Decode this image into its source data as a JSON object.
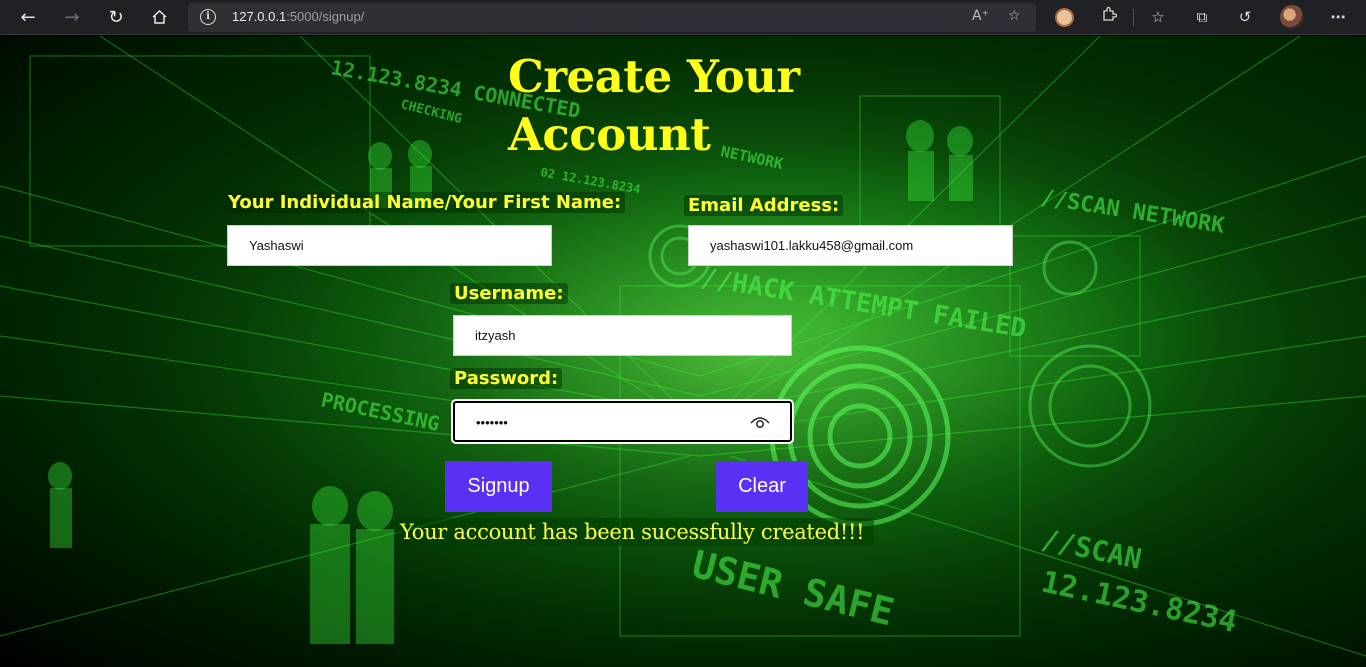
{
  "browser": {
    "url_host": "127.0.0.1",
    "url_rest": ":5000/signup/",
    "icons": [
      "back-icon",
      "forward-icon",
      "refresh-icon",
      "home-icon",
      "info-icon",
      "read-aloud-icon",
      "favorite-add-icon",
      "extension-icon",
      "favorites-icon",
      "collections-icon",
      "history-icon",
      "profile-avatar",
      "more-icon"
    ]
  },
  "form": {
    "title": "Create Your Account",
    "name_label": "Your Individual Name/Your First Name:",
    "name_value": "Yashaswi",
    "email_label": "Email Address:",
    "email_value": "yashaswi101.lakku458@gmail.com",
    "username_label": "Username:",
    "username_value": "itzyash",
    "password_label": "Password:",
    "password_value": "•••••••",
    "signup_label": "Signup",
    "clear_label": "Clear",
    "success_message": "Your account has been sucessfully created!!!"
  },
  "background_text": {
    "t1": "12.123.8234 CONNECTED",
    "t2": "CHECKING",
    "t3": "NETWORK",
    "t4": "//SCAN NETWORK",
    "t5": "//HACK ATTEMPT FAILED",
    "t6": "PROCESSING",
    "t7": "USER SAFE",
    "t8": "//SCAN",
    "t9": "12.123.8234",
    "t10": "02 12.123.8234"
  },
  "colors": {
    "accent_button": "#5a30f5",
    "title_yellow": "#ffff1a",
    "matrix_green": "#39ff39"
  }
}
